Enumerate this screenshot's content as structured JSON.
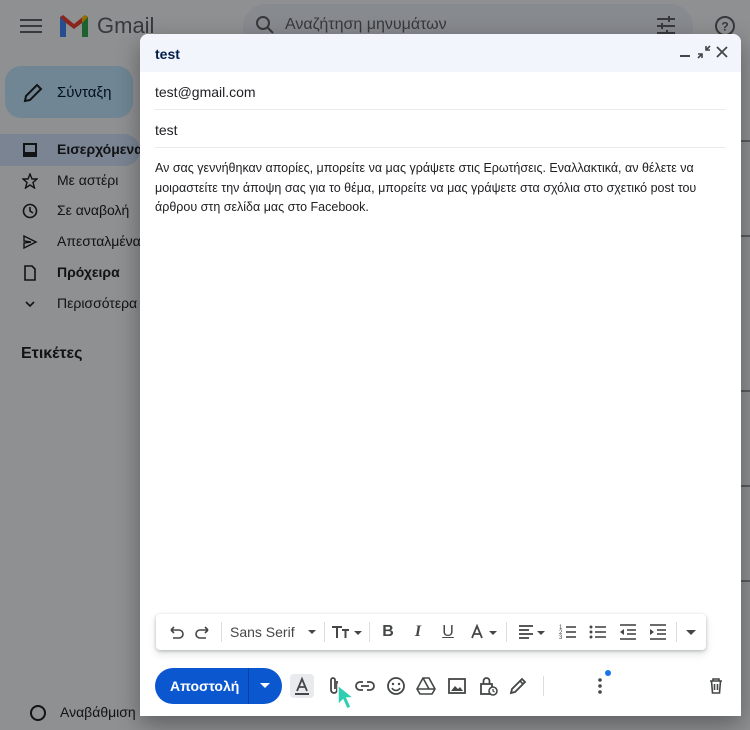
{
  "app": {
    "logo_text": "Gmail",
    "search_placeholder": "Αναζήτηση μηνυμάτων",
    "compose_label": "Σύνταξη",
    "labels_title": "Ετικέτες",
    "upgrade_label": "Αναβάθμιση"
  },
  "sidebar": {
    "items": [
      {
        "label": "Εισερχόμενα",
        "icon": "inbox-icon",
        "active": true
      },
      {
        "label": "Με αστέρι",
        "icon": "star-icon",
        "active": false
      },
      {
        "label": "Σε αναβολή",
        "icon": "clock-icon",
        "active": false
      },
      {
        "label": "Απεσταλμένα",
        "icon": "send-icon",
        "active": false
      },
      {
        "label": "Πρόχειρα",
        "icon": "draft-icon",
        "active": false
      },
      {
        "label": "Περισσότερα",
        "icon": "chevron-down-icon",
        "active": false
      }
    ]
  },
  "compose": {
    "title": "test",
    "to": "test@gmail.com",
    "subject": "test",
    "body_line1": "Αν σας γεννήθηκαν απορίες, μπορείτε να μας γράψετε στις Ερωτήσεις. Εναλλακτικά, αν θέλετε να",
    "body_line2": "μοιραστείτε την άποψη σας για το θέμα, μπορείτε να μας γράψετε στα σχόλια στο σχετικό post του",
    "body_line3": "άρθρου στη σελίδα μας στο Facebook.",
    "send_label": "Αποστολή",
    "font_name": "Sans Serif"
  },
  "colors": {
    "accent": "#0b57d0",
    "compose_button": "#c2e7ff",
    "header_bg": "#f2f6fc"
  }
}
